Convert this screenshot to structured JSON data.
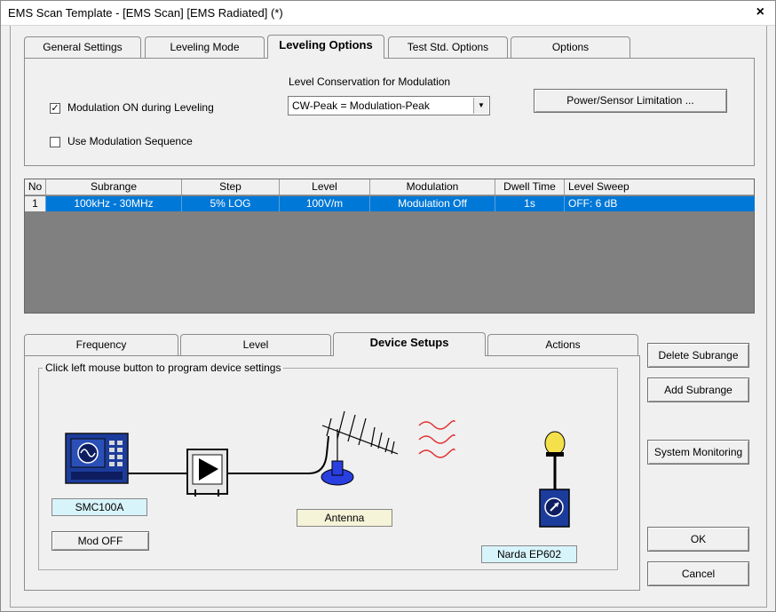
{
  "window": {
    "title": "EMS Scan Template - [EMS Scan] [EMS Radiated] (*)",
    "close": "×"
  },
  "top_tabs": [
    "General Settings",
    "Leveling Mode",
    "Leveling Options",
    "Test Std. Options",
    "Options"
  ],
  "leveling_options": {
    "modulation_on": {
      "label": "Modulation ON during Leveling",
      "checked": "✓"
    },
    "use_sequence": {
      "label": "Use Modulation Sequence"
    },
    "level_conservation_label": "Level Conservation for Modulation",
    "level_conservation_value": "CW-Peak = Modulation-Peak",
    "power_sensor_button": "Power/Sensor Limitation ..."
  },
  "table": {
    "headers": [
      "No",
      "Subrange",
      "Step",
      "Level",
      "Modulation",
      "Dwell Time",
      "Level Sweep"
    ],
    "rows": [
      [
        "1",
        "100kHz - 30MHz",
        "5% LOG",
        "100V/m",
        "Modulation Off",
        "1s",
        "OFF: 6 dB"
      ]
    ]
  },
  "bottom_tabs": [
    "Frequency",
    "Level",
    "Device Setups",
    "Actions"
  ],
  "device_setups": {
    "group_label": "Click left mouse button to program device settings",
    "generator": "SMC100A",
    "mod_button": "Mod OFF",
    "antenna": "Antenna",
    "probe": "Narda EP602"
  },
  "side_buttons": {
    "delete": "Delete Subrange",
    "add": "Add Subrange",
    "monitoring": "System Monitoring",
    "ok": "OK",
    "cancel": "Cancel"
  },
  "colors": {
    "selection": "#0078d7",
    "label_bg": "#d8f4fb",
    "device_blue": "#1c3c9c",
    "probe_yellow": "#f4e04a"
  }
}
